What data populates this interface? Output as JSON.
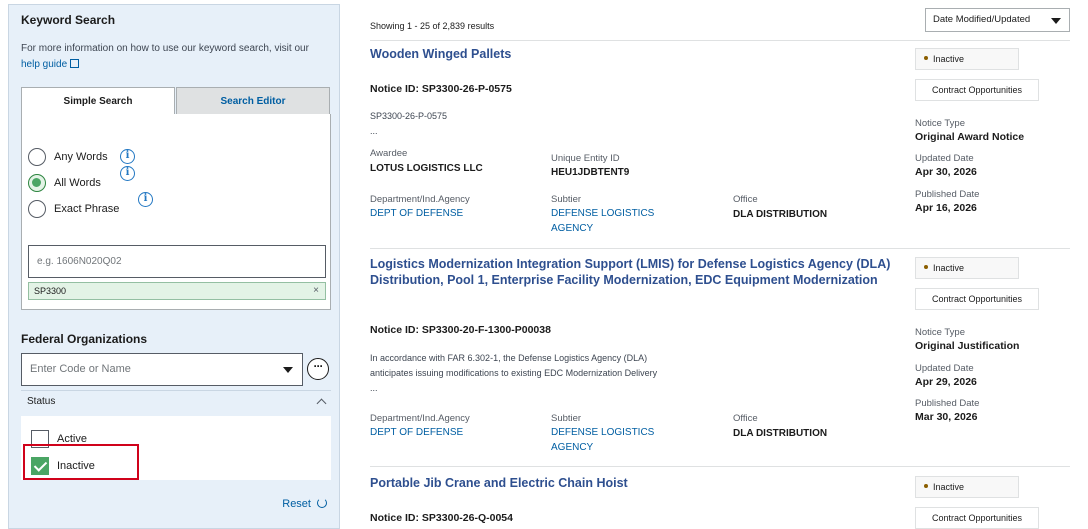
{
  "sidebar": {
    "keyword_title": "Keyword Search",
    "info_text": "For more information on how to use our keyword search, visit our",
    "help_link": "help guide",
    "tabs": [
      {
        "label": "Simple Search",
        "active": true
      },
      {
        "label": "Search Editor",
        "active": false
      }
    ],
    "radios": [
      {
        "label": "Any Words",
        "checked": false
      },
      {
        "label": "All Words",
        "checked": true
      },
      {
        "label": "Exact Phrase",
        "checked": false
      }
    ],
    "keyword_placeholder": "e.g. 1606N020Q02",
    "chip_value": "SP3300",
    "chip_remove": "×",
    "fed_org_title": "Federal Organizations",
    "fed_org_placeholder": "Enter Code or Name",
    "more_label": "···",
    "status_label": "Status",
    "status_options": [
      {
        "label": "Active",
        "checked": false
      },
      {
        "label": "Inactive",
        "checked": true
      }
    ],
    "reset_label": "Reset"
  },
  "results_header": {
    "showing": "Showing 1 - 25 of 2,839 results",
    "sort_value": "Date Modified/Updated"
  },
  "results": [
    {
      "title": "Wooden Winged Pallets",
      "notice_id": "Notice ID: SP3300-26-P-0575",
      "desc_line1": "SP3300-26-P-0575",
      "desc_line2": "...",
      "awardee_label": "Awardee",
      "awardee": "LOTUS LOGISTICS LLC",
      "uei_label": "Unique Entity ID",
      "uei": "HEU1JDBTENT9",
      "dept_label": "Department/Ind.Agency",
      "dept": "DEPT OF DEFENSE",
      "subtier_label": "Subtier",
      "subtier": "DEFENSE LOGISTICS AGENCY",
      "office_label": "Office",
      "office": "DLA DISTRIBUTION",
      "status": "Inactive",
      "type_tag": "Contract Opportunities",
      "notice_type_label": "Notice Type",
      "notice_type": "Original Award Notice",
      "updated_label": "Updated Date",
      "updated": "Apr 30, 2026",
      "published_label": "Published Date",
      "published": "Apr 16, 2026"
    },
    {
      "title": "Logistics Modernization Integration Support (LMIS) for Defense Logistics Agency (DLA) Distribution, Pool 1, Enterprise Facility Modernization, EDC Equipment Modernization",
      "notice_id": "Notice ID: SP3300-20-F-1300-P00038",
      "desc_line1": "In accordance with FAR 6.302-1, the Defense Logistics Agency (DLA)",
      "desc_line2": "anticipates issuing modifications to existing EDC Modernization Delivery",
      "desc_line3": "...",
      "dept_label": "Department/Ind.Agency",
      "dept": "DEPT OF DEFENSE",
      "subtier_label": "Subtier",
      "subtier": "DEFENSE LOGISTICS AGENCY",
      "office_label": "Office",
      "office": "DLA DISTRIBUTION",
      "status": "Inactive",
      "type_tag": "Contract Opportunities",
      "notice_type_label": "Notice Type",
      "notice_type": "Original Justification",
      "updated_label": "Updated Date",
      "updated": "Apr 29, 2026",
      "published_label": "Published Date",
      "published": "Mar 30, 2026"
    },
    {
      "title": "Portable Jib Crane and Electric Chain Hoist",
      "notice_id": "Notice ID: SP3300-26-Q-0054",
      "status": "Inactive",
      "type_tag": "Contract Opportunities"
    }
  ],
  "colors": {
    "sidebar_bg": "#e7f0f9",
    "link": "#005ea2",
    "title": "#2e4f8f",
    "checked_green": "#4aa564",
    "highlight_red": "#d0021b"
  }
}
